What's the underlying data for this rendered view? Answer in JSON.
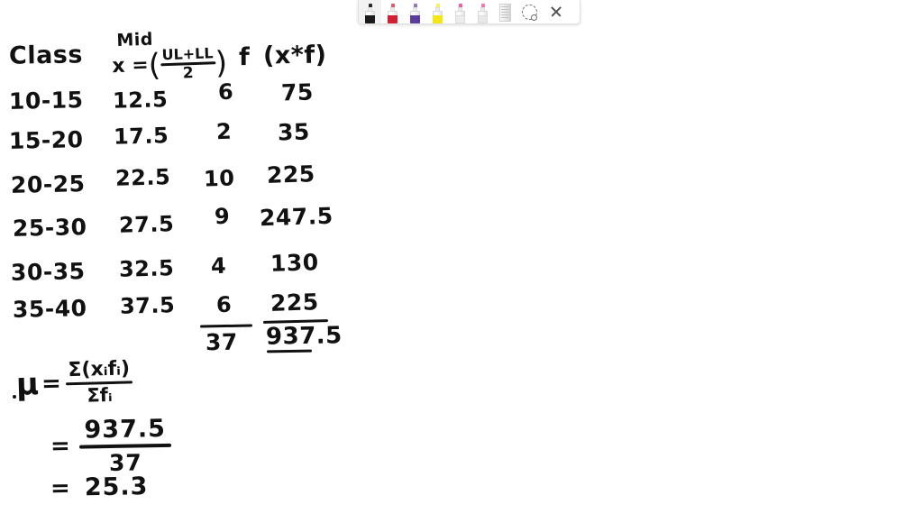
{
  "toolbar": {
    "tools": [
      {
        "name": "black-marker",
        "label": "Black marker",
        "color": "#1b1b1b",
        "tip": "#2b2b2b",
        "selected": true
      },
      {
        "name": "red-marker",
        "label": "Red marker",
        "color": "#d41f31",
        "tip": "#e05a66",
        "selected": false
      },
      {
        "name": "purple-marker",
        "label": "Purple marker",
        "color": "#5b3d9e",
        "tip": "#8e79c4",
        "selected": false
      },
      {
        "name": "yellow-marker",
        "label": "Yellow highlighter",
        "color": "#f2e617",
        "tip": "#f6ef5a",
        "selected": false
      },
      {
        "name": "white-marker-1",
        "label": "White marker",
        "color": "#ededed",
        "tip": "#ef5fa0",
        "selected": false
      },
      {
        "name": "white-marker-2",
        "label": "White marker",
        "color": "#e8e8e8",
        "tip": "#f07ab0",
        "selected": false
      }
    ],
    "eraser_label": "Eraser",
    "select_label": "Lasso select",
    "close_label": "Close toolbar"
  },
  "worksheet": {
    "headers": {
      "class": "Class",
      "mid_word": "Mid",
      "mid_var": "x =",
      "mid_numerator": "UL+LL",
      "mid_denominator": "2",
      "frequency": "f",
      "product": "(x*f)"
    },
    "rows": [
      {
        "class": "10-15",
        "mid": "12.5",
        "f": "6",
        "xf": "75"
      },
      {
        "class": "15-20",
        "mid": "17.5",
        "f": "2",
        "xf": "35"
      },
      {
        "class": "20-25",
        "mid": "22.5",
        "f": "10",
        "xf": "225"
      },
      {
        "class": "25-30",
        "mid": "27.5",
        "f": "9",
        "xf": "247.5"
      },
      {
        "class": "30-35",
        "mid": "32.5",
        "f": "4",
        "xf": "130"
      },
      {
        "class": "35-40",
        "mid": "37.5",
        "f": "6",
        "xf": "225"
      }
    ],
    "totals": {
      "f": "37",
      "xf": "937.5"
    },
    "formula": {
      "mu": "μ",
      "equals": "=",
      "numerator": "Σ(xᵢfᵢ)",
      "denominator": "Σfᵢ"
    },
    "substitution": {
      "equals": "=",
      "numerator": "937.5",
      "denominator": "37"
    },
    "result": {
      "equals": "=",
      "value": "25.3"
    }
  }
}
